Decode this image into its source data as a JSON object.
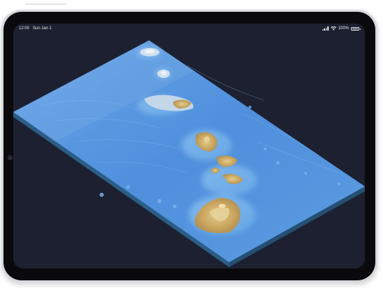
{
  "status_bar": {
    "time": "12:00",
    "date": "Sun Jan 1",
    "battery_percent": "100%",
    "wifi_icon": "wifi-icon",
    "signal_icon": "cellular-signal-icon",
    "battery_icon": "battery-icon"
  },
  "colors": {
    "screen_background": "#1c2030",
    "ocean": "#4f8fdc",
    "ocean_shallow": "#7bb6ef",
    "land": "#c9a45e",
    "land_peak": "#e0c98a",
    "frame": "#d7d9dc"
  }
}
